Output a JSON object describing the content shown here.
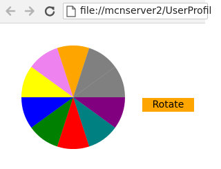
{
  "browser": {
    "url": "file://mcnserver2/UserProfil",
    "back_icon": "back-arrow-icon",
    "forward_icon": "forward-arrow-icon",
    "reload_icon": "reload-icon",
    "page_icon": "page-icon"
  },
  "main": {
    "rotate_label": "Rotate",
    "rotate_color": "#ffa500"
  },
  "pie": {
    "slices": [
      {
        "color": "#808080",
        "value": 1
      },
      {
        "color": "#800080",
        "value": 1
      },
      {
        "color": "#008080",
        "value": 1
      },
      {
        "color": "#ff0000",
        "value": 1
      },
      {
        "color": "#008000",
        "value": 1
      },
      {
        "color": "#0000ff",
        "value": 1
      },
      {
        "color": "#ffff00",
        "value": 1
      },
      {
        "color": "#ee82ee",
        "value": 1
      },
      {
        "color": "#ffa500",
        "value": 1
      },
      {
        "color": "#808080",
        "value": 1
      }
    ]
  }
}
